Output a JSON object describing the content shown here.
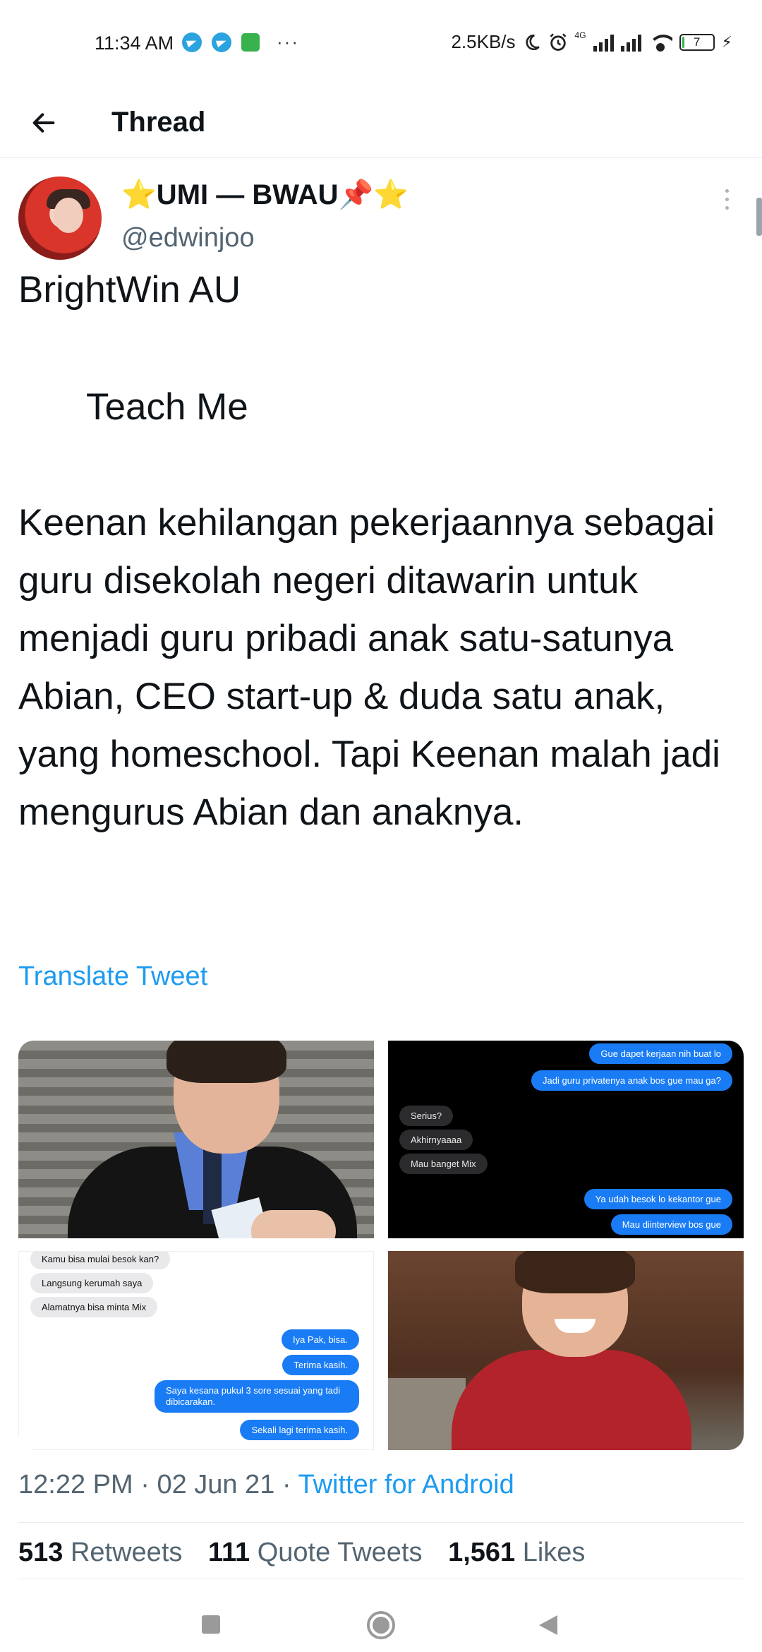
{
  "status_bar": {
    "time": "11:34 AM",
    "more": "···",
    "speed": "2.5KB/s",
    "network": "4G",
    "battery": "7",
    "battery_level_percent": 7
  },
  "header": {
    "title": "Thread"
  },
  "tweet": {
    "display_name": "⭐UMI — BWAU📌⭐",
    "handle": "@edwinjoo",
    "text_line1": "BrightWin AU",
    "text_line2": "Teach Me",
    "text_body": "Keenan kehilangan pekerjaannya sebagai guru disekolah negeri ditawarin untuk menjadi guru pribadi anak satu-satunya Abian, CEO start-up & duda satu anak, yang homeschool. Tapi Keenan malah jadi mengurus Abian dan anaknya.",
    "translate": "Translate Tweet",
    "time": "12:22 PM",
    "date": "02 Jun 21",
    "sep": "·",
    "source": "Twitter for Android",
    "retweets_count": "513",
    "retweets_label": "Retweets",
    "quotes_count": "111",
    "quotes_label": "Quote Tweets",
    "likes_count": "1,561",
    "likes_label": "Likes"
  },
  "media": {
    "chat1": {
      "m1": "Gue dapet kerjaan nih buat lo",
      "m2": "Jadi guru privatenya anak bos gue mau ga?",
      "m3": "Serius?",
      "m4": "Akhirnyaaaa",
      "m5": "Mau banget Mix",
      "m6": "Ya udah besok lo kekantor gue",
      "m7": "Mau diinterview bos gue"
    },
    "chat2": {
      "m1": "Kamu bisa mulai besok kan?",
      "m2": "Langsung kerumah saya",
      "m3": "Alamatnya bisa minta Mix",
      "m4": "Iya Pak, bisa.",
      "m5": "Terima kasih.",
      "m6a": "Saya kesana pukul 3 sore sesuai yang tadi",
      "m6b": "dibicarakan.",
      "m7": "Sekali lagi terima kasih."
    }
  },
  "colors": {
    "accent": "#1d9bf0",
    "text": "#0f1419",
    "secondary": "#536471",
    "imessage_blue": "#1a7cf5"
  },
  "icons": [
    "telegram-icon",
    "app-icon",
    "moon-icon",
    "alarm-icon",
    "signal-icon",
    "wifi-icon",
    "battery-icon",
    "back-arrow-icon",
    "more-vertical-icon",
    "nav-recent-icon",
    "nav-home-icon",
    "nav-back-icon"
  ]
}
